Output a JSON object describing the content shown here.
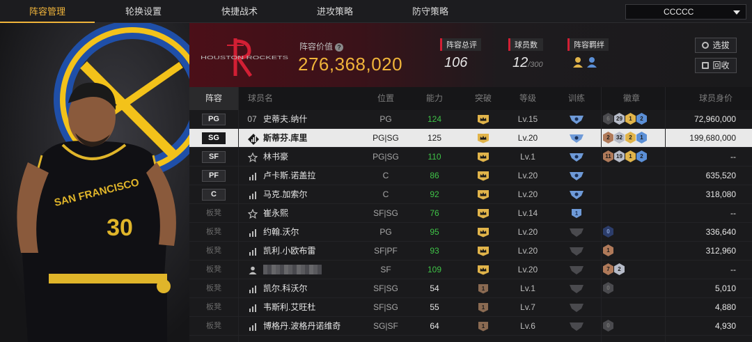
{
  "nav": {
    "tabs": [
      {
        "label": "阵容管理",
        "active": true
      },
      {
        "label": "轮换设置",
        "active": false
      },
      {
        "label": "快捷战术",
        "active": false
      },
      {
        "label": "进攻策略",
        "active": false
      },
      {
        "label": "防守策略",
        "active": false
      }
    ],
    "team_select": "CCCCC"
  },
  "banner": {
    "logo_text": "HOUSTON ROCKETS",
    "value_label": "阵容价值",
    "value": "276,368,020",
    "stats": [
      {
        "label": "阵容总评",
        "value": "106",
        "sub": ""
      },
      {
        "label": "球员数",
        "value": "12",
        "sub": "/300"
      },
      {
        "label": "阵容羁绊",
        "value": "",
        "sub": ""
      }
    ],
    "buttons": {
      "select": "选拔",
      "recycle": "回收"
    }
  },
  "table": {
    "headers": [
      "阵容",
      "球员名",
      "位置",
      "能力",
      "突破",
      "等级",
      "训练",
      "徽章",
      "球员身价"
    ],
    "rows": [
      {
        "slot": "PG",
        "bench": false,
        "num": "07",
        "icon": "number",
        "name": "史蒂夫.纳什",
        "pos": "PG",
        "ability": "124",
        "ability_color": "green",
        "break": "crown",
        "level": "Lv.15",
        "train": "train-blue",
        "badges": [
          {
            "t": "dark",
            "v": "6"
          },
          {
            "t": "silver",
            "v": "29"
          },
          {
            "t": "gold",
            "v": "1"
          },
          {
            "t": "blue",
            "v": "2"
          }
        ],
        "salary": "72,960,000",
        "selected": false
      },
      {
        "slot": "SG",
        "bench": false,
        "num": "",
        "icon": "bars-diamond",
        "name": "斯蒂芬.库里",
        "pos": "PG|SG",
        "ability": "125",
        "ability_color": "white",
        "break": "crown",
        "level": "Lv.20",
        "train": "train-blue",
        "badges": [
          {
            "t": "bronze",
            "v": "2"
          },
          {
            "t": "silver",
            "v": "32"
          },
          {
            "t": "gold",
            "v": "2"
          },
          {
            "t": "blue",
            "v": "1"
          }
        ],
        "salary": "199,680,000",
        "selected": true
      },
      {
        "slot": "SF",
        "bench": false,
        "num": "",
        "icon": "star",
        "name": "林书豪",
        "pos": "PG|SG",
        "ability": "110",
        "ability_color": "green",
        "break": "crown",
        "level": "Lv.1",
        "train": "train-blue",
        "badges": [
          {
            "t": "bronze",
            "v": "11"
          },
          {
            "t": "silver",
            "v": "19"
          },
          {
            "t": "gold",
            "v": "1"
          },
          {
            "t": "blue",
            "v": "2"
          }
        ],
        "salary": "--",
        "selected": false
      },
      {
        "slot": "PF",
        "bench": false,
        "num": "",
        "icon": "bars",
        "name": "卢卡斯.诺盖拉",
        "pos": "C",
        "ability": "86",
        "ability_color": "green",
        "break": "crown",
        "level": "Lv.20",
        "train": "train-blue",
        "badges": [],
        "salary": "635,520",
        "selected": false
      },
      {
        "slot": "C",
        "bench": false,
        "num": "",
        "icon": "bars",
        "name": "马克.加索尔",
        "pos": "C",
        "ability": "92",
        "ability_color": "green",
        "break": "crown",
        "level": "Lv.20",
        "train": "train-blue",
        "badges": [],
        "salary": "318,080",
        "selected": false
      },
      {
        "slot": "板凳",
        "bench": true,
        "num": "",
        "icon": "star",
        "name": "崔永熙",
        "pos": "SF|SG",
        "ability": "76",
        "ability_color": "green",
        "break": "crown",
        "level": "Lv.14",
        "train": "train-blue-1",
        "badges": [],
        "salary": "--",
        "selected": false
      },
      {
        "slot": "板凳",
        "bench": true,
        "num": "",
        "icon": "bars",
        "name": "约翰.沃尔",
        "pos": "PG",
        "ability": "95",
        "ability_color": "green",
        "break": "crown",
        "level": "Lv.20",
        "train": "train-gray",
        "badges": [
          {
            "t": "darkblue",
            "v": "0"
          }
        ],
        "salary": "336,640",
        "selected": false
      },
      {
        "slot": "板凳",
        "bench": true,
        "num": "",
        "icon": "bars",
        "name": "凯利.小欧布雷",
        "pos": "SF|PF",
        "ability": "93",
        "ability_color": "green",
        "break": "crown",
        "level": "Lv.20",
        "train": "train-gray",
        "badges": [
          {
            "t": "bronze",
            "v": "1"
          }
        ],
        "salary": "312,960",
        "selected": false
      },
      {
        "slot": "板凳",
        "bench": true,
        "num": "",
        "icon": "person",
        "name": "",
        "pos": "SF",
        "ability": "109",
        "ability_color": "green",
        "break": "crown",
        "level": "Lv.20",
        "train": "train-gray",
        "badges": [
          {
            "t": "bronze",
            "v": "7"
          },
          {
            "t": "silver",
            "v": "2"
          }
        ],
        "salary": "--",
        "selected": false
      },
      {
        "slot": "板凳",
        "bench": true,
        "num": "",
        "icon": "bars",
        "name": "凯尔.科沃尔",
        "pos": "SF|SG",
        "ability": "54",
        "ability_color": "white",
        "break": "one",
        "level": "Lv.1",
        "train": "train-gray",
        "badges": [
          {
            "t": "dark",
            "v": "0"
          }
        ],
        "salary": "5,010",
        "selected": false
      },
      {
        "slot": "板凳",
        "bench": true,
        "num": "",
        "icon": "bars",
        "name": "韦斯利.艾旺杜",
        "pos": "SF|SG",
        "ability": "55",
        "ability_color": "white",
        "break": "one",
        "level": "Lv.7",
        "train": "train-gray",
        "badges": [],
        "salary": "4,880",
        "selected": false
      },
      {
        "slot": "板凳",
        "bench": true,
        "num": "",
        "icon": "bars",
        "name": "博格丹.波格丹诺维奇",
        "pos": "SG|SF",
        "ability": "64",
        "ability_color": "white",
        "break": "one",
        "level": "Lv.6",
        "train": "train-gray",
        "badges": [
          {
            "t": "dark",
            "v": "0"
          }
        ],
        "salary": "4,930",
        "selected": false
      }
    ]
  },
  "player_art": {
    "jersey_text": "SAN FRANCISCO",
    "jersey_number": "30"
  }
}
